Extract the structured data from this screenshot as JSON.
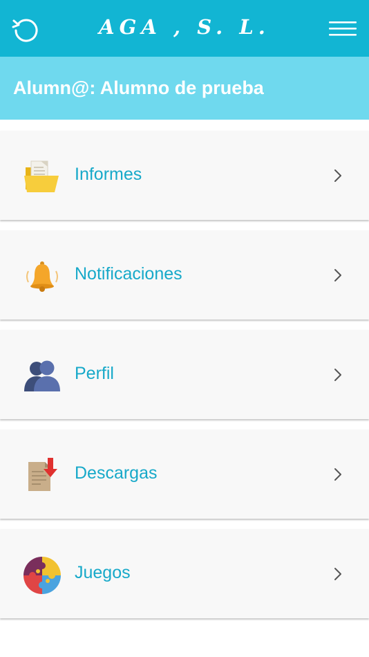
{
  "header": {
    "title": "AGA , S. L.",
    "back_icon": "refresh-back-icon",
    "menu_icon": "hamburger-menu-icon",
    "color": "#12b5d3"
  },
  "subheader": {
    "title": "Alumn@: Alumno de prueba",
    "color": "#6fd9ee"
  },
  "menu": {
    "items": [
      {
        "label": "Informes",
        "icon": "folder-document-icon"
      },
      {
        "label": "Notificaciones",
        "icon": "bell-icon"
      },
      {
        "label": "Perfil",
        "icon": "users-profile-icon"
      },
      {
        "label": "Descargas",
        "icon": "download-document-icon"
      },
      {
        "label": "Juegos",
        "icon": "puzzle-icon"
      }
    ],
    "label_color": "#17a9c9",
    "chevron_icon": "chevron-right-icon"
  }
}
